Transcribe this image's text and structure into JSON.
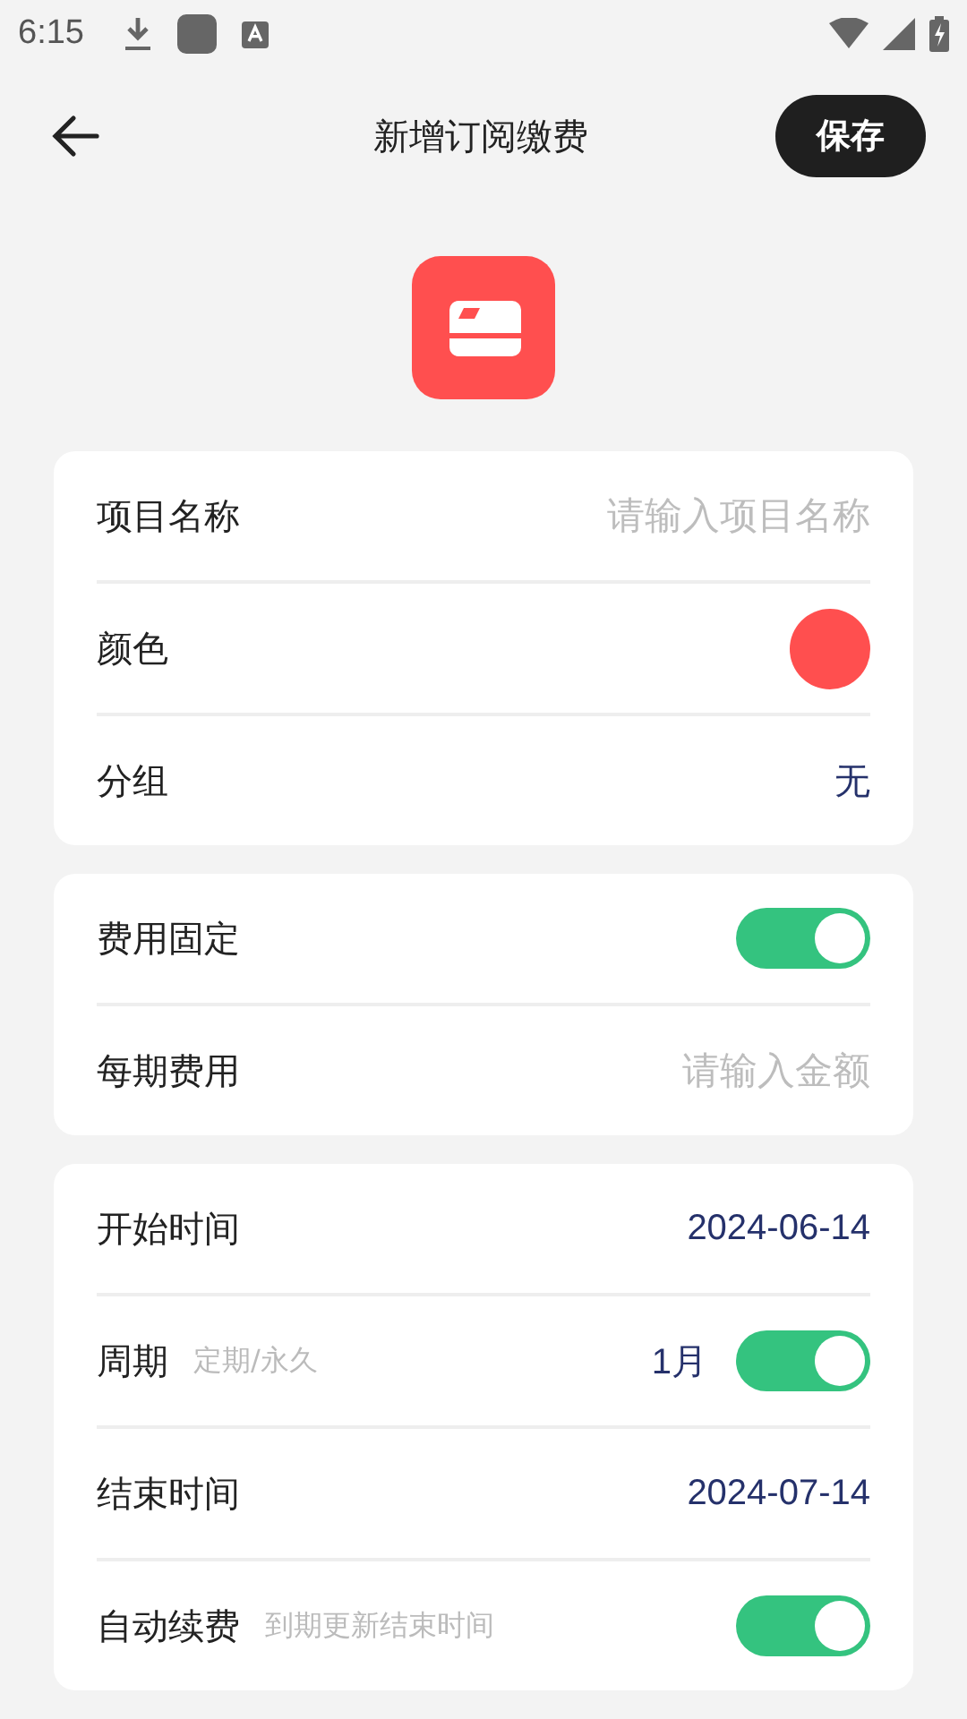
{
  "status_bar": {
    "time": "6:15"
  },
  "header": {
    "title": "新增订阅缴费",
    "save_button": "保存"
  },
  "sections": [
    {
      "rows": [
        {
          "kind": "input",
          "label": "项目名称",
          "placeholder": "请输入项目名称"
        },
        {
          "kind": "color",
          "label": "颜色",
          "color": "#ff4f4f"
        },
        {
          "kind": "value",
          "label": "分组",
          "value": "无"
        }
      ]
    },
    {
      "rows": [
        {
          "kind": "toggle",
          "label": "费用固定",
          "on": true
        },
        {
          "kind": "input",
          "label": "每期费用",
          "placeholder": "请输入金额"
        }
      ]
    },
    {
      "rows": [
        {
          "kind": "value",
          "label": "开始时间",
          "value": "2024-06-14"
        },
        {
          "kind": "toggle",
          "label": "周期",
          "hint": "定期/永久",
          "value": "1月",
          "on": true
        },
        {
          "kind": "value",
          "label": "结束时间",
          "value": "2024-07-14"
        },
        {
          "kind": "toggle",
          "label": "自动续费",
          "hint": "到期更新结束时间",
          "on": true
        }
      ]
    }
  ]
}
